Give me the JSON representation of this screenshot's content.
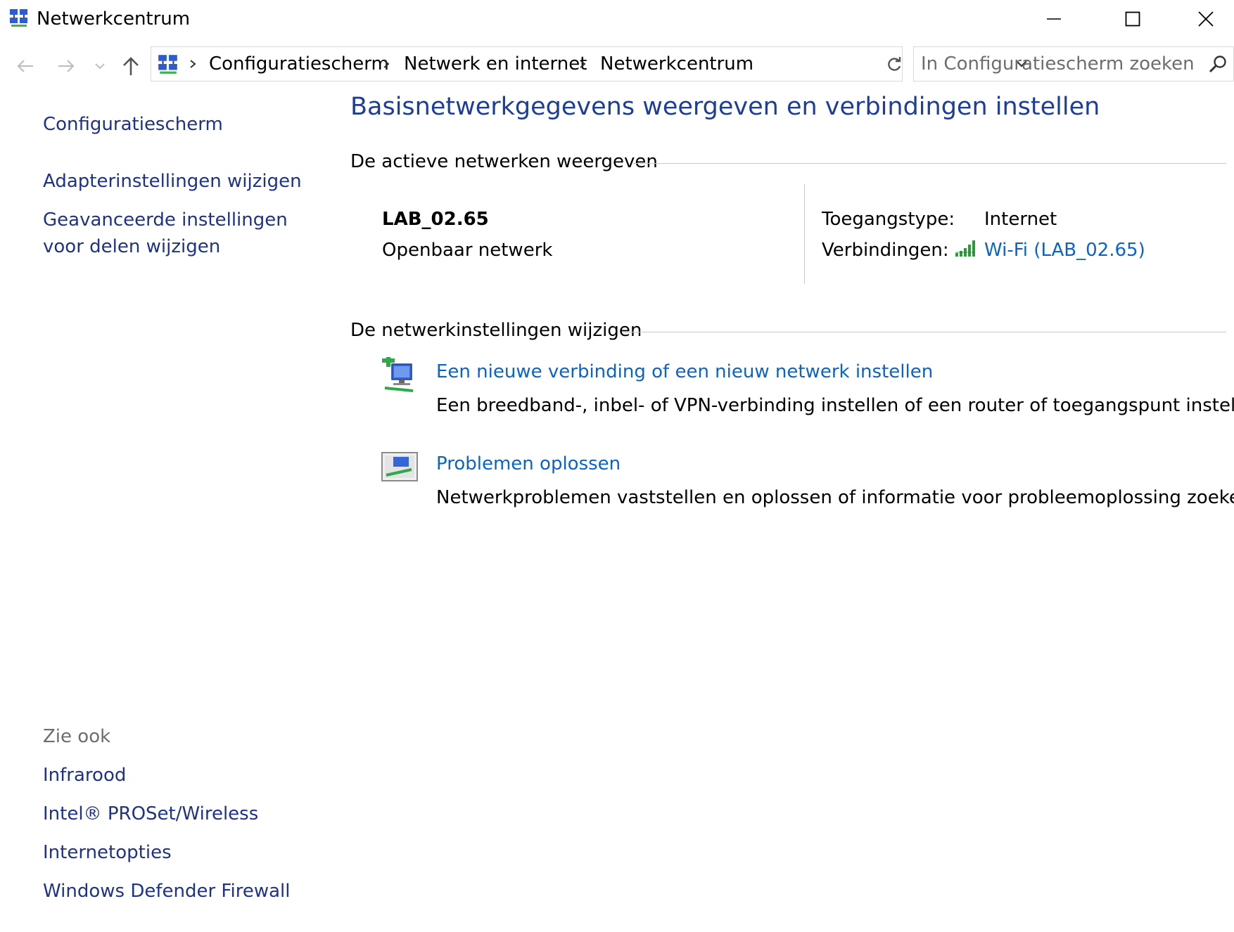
{
  "window": {
    "title": "Netwerkcentrum"
  },
  "address_bar": {
    "breadcrumbs": [
      "Configuratiescherm",
      "Netwerk en internet",
      "Netwerkcentrum"
    ]
  },
  "search": {
    "placeholder": "In Configuratiescherm zoeken"
  },
  "sidebar": {
    "links": [
      "Configuratiescherm",
      "Adapterinstellingen wijzigen",
      "Geavanceerde instellingen",
      "voor delen wijzigen"
    ],
    "see_also": {
      "heading": "Zie ook",
      "links": [
        "Infrarood",
        "Intel® PROSet/Wireless",
        "Internetopties",
        "Windows Defender Firewall"
      ]
    }
  },
  "main": {
    "title": "Basisnetwerkgegevens weergeven en verbindingen instellen",
    "active_networks": {
      "heading": "De actieve netwerken weergeven",
      "network_name": "LAB_02.65",
      "network_type": "Openbaar netwerk",
      "access_type_label": "Toegangstype:",
      "access_type_value": "Internet",
      "connections_label": "Verbindingen:",
      "connection_link": "Wi-Fi (LAB_02.65)"
    },
    "change_settings": {
      "heading": "De netwerkinstellingen wijzigen",
      "items": [
        {
          "title": "Een nieuwe verbinding of een nieuw netwerk instellen",
          "description": "Een breedband-, inbel- of VPN-verbinding instellen of een router of toegangspunt instellen.",
          "icon": "new-connection-icon"
        },
        {
          "title": "Problemen oplossen",
          "description": "Netwerkproblemen vaststellen en oplossen of informatie voor probleemoplossing zoeken.",
          "icon": "troubleshoot-icon"
        }
      ]
    }
  },
  "colors": {
    "link_dark": "#1e3287",
    "link_bright": "#0a64c8",
    "title_blue": "#1c3e96",
    "muted": "#6d6d6d"
  }
}
